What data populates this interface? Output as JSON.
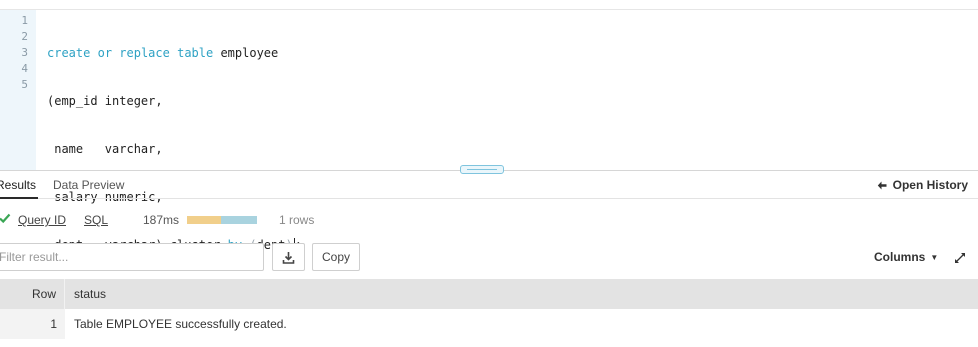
{
  "editor": {
    "line_numbers": [
      "1",
      "2",
      "3",
      "4",
      "5"
    ],
    "lines": [
      "create or replace table employee",
      "(emp_id integer,",
      " name   varchar,",
      " salary numeric,",
      " dept   varchar) cluster by (dept);"
    ],
    "tokens": {
      "line1": {
        "kw1": "create",
        "sp1": " ",
        "kw2": "or",
        "sp2": " ",
        "kw3": "replace",
        "sp3": " ",
        "kw4": "table",
        "rest": " employee"
      },
      "line2": "(emp_id integer,",
      "line3": " name   varchar,",
      "line4": " salary numeric,",
      "line5": {
        "pre": " dept   varchar) cluster ",
        "kw": "by",
        "sp": " ",
        "open": "(",
        "arg": "dept",
        "close": ")",
        "end": ";"
      }
    },
    "keyword_color": "#2ea2c4"
  },
  "results": {
    "tabs": [
      {
        "label": "Results",
        "active": true
      },
      {
        "label": "Data Preview",
        "active": false
      }
    ],
    "open_history_label": "Open History",
    "open_history_icon": "arrow-left-icon"
  },
  "query": {
    "status_icon": "check-icon",
    "query_id_label": "Query ID",
    "sql_label": "SQL",
    "duration": "187ms",
    "progress_fraction": 0.48,
    "progress_colors": {
      "compile": "#f1cf8b",
      "execute": "#a9d3df"
    },
    "rows_label": "1 rows"
  },
  "toolbar": {
    "filter_placeholder": "Filter result...",
    "filter_value": "",
    "download_icon": "download-icon",
    "copy_label": "Copy",
    "columns_label": "Columns",
    "expand_icon": "expand-icon"
  },
  "table": {
    "columns": [
      "Row",
      "status"
    ],
    "rows": [
      {
        "row": "1",
        "status": "Table EMPLOYEE successfully created."
      }
    ]
  }
}
